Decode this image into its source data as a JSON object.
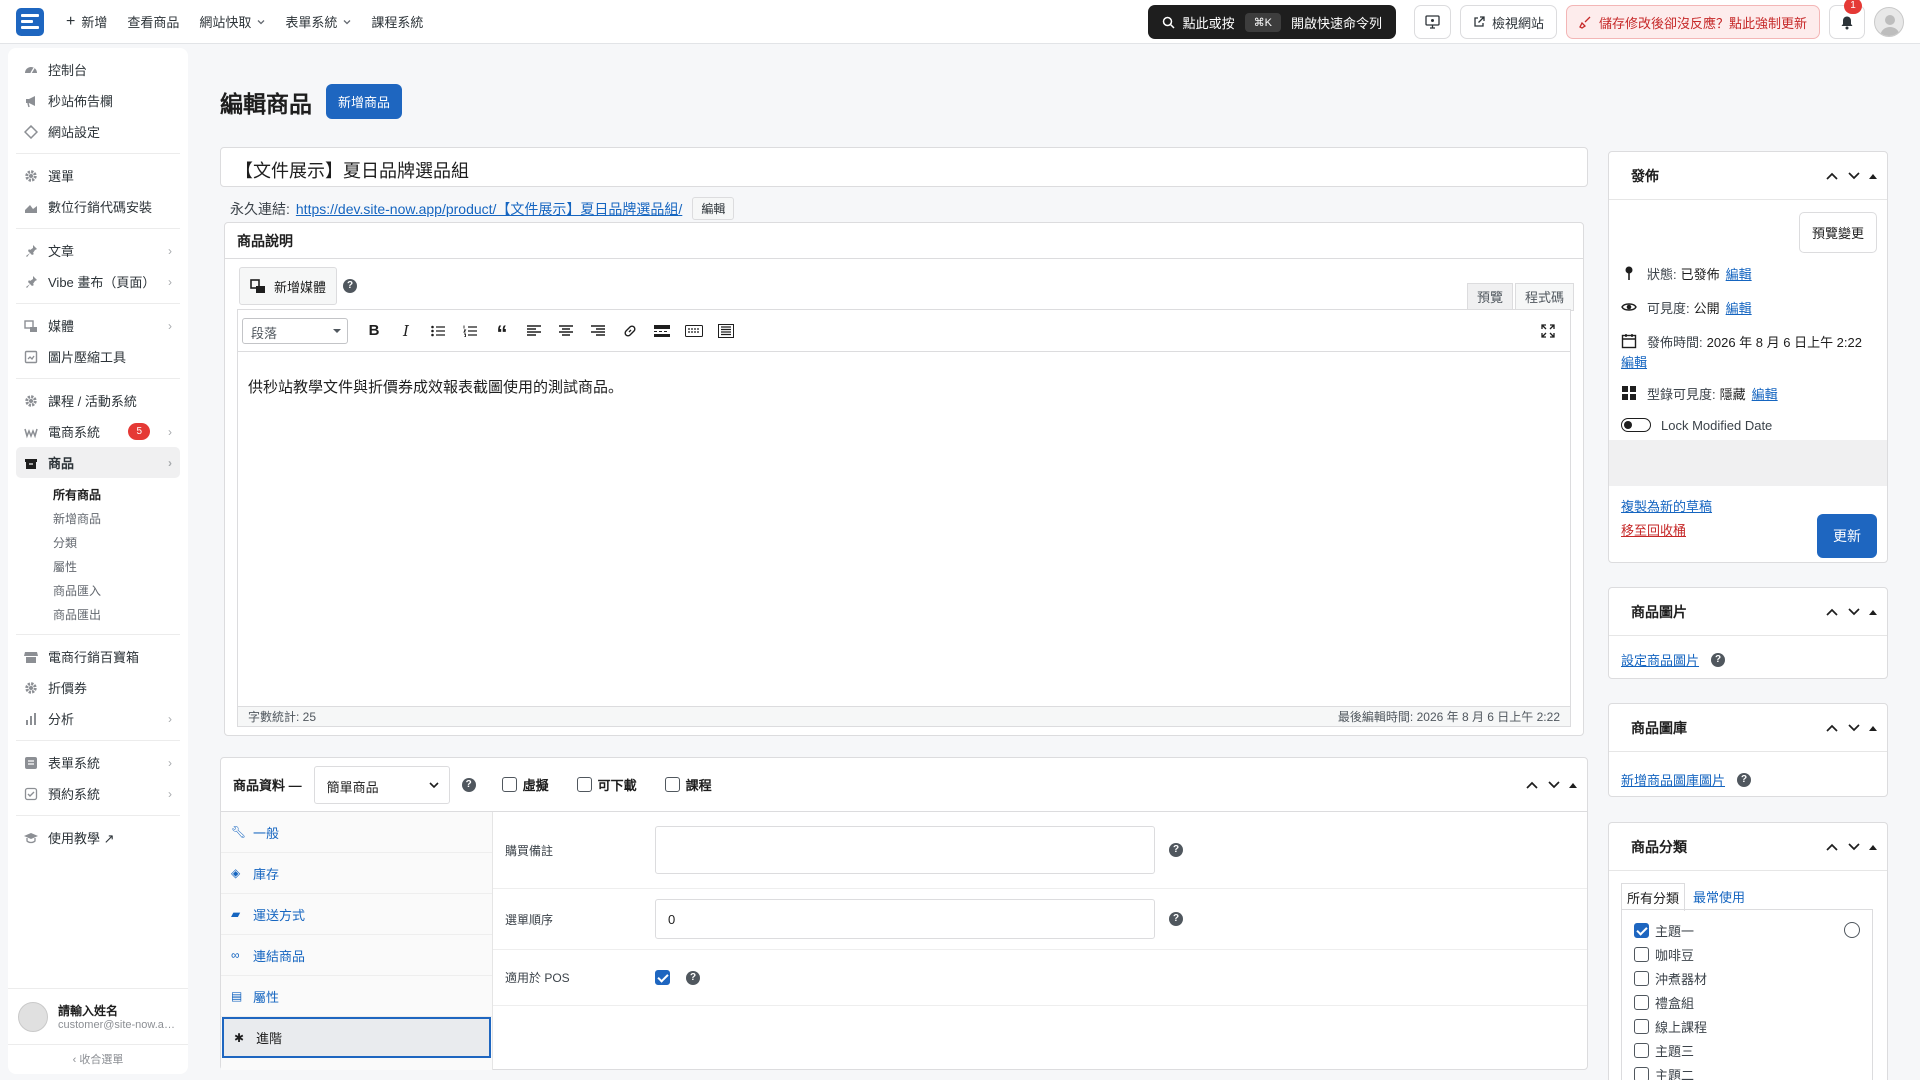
{
  "topbar": {
    "nav": [
      {
        "label": "新增",
        "icon": "plus-icon"
      },
      {
        "label": "查看商品"
      },
      {
        "label": "網站快取",
        "dropdown": true
      },
      {
        "label": "表單系統",
        "dropdown": true
      },
      {
        "label": "課程系統"
      }
    ],
    "command": {
      "prefix": "點此或按",
      "shortcut": "⌘K",
      "suffix": "開啟快速命令列"
    },
    "view_site": "檢視網站",
    "warning": "儲存修改後卻沒反應？點此強制更新",
    "notification_count": "1"
  },
  "sidebar": {
    "groups": [
      [
        {
          "label": "控制台",
          "icon": "dashboard-icon"
        },
        {
          "label": "秒站佈告欄",
          "icon": "megaphone-icon"
        },
        {
          "label": "網站設定",
          "icon": "diamond-icon"
        }
      ],
      [
        {
          "label": "選單",
          "icon": "gear-icon"
        },
        {
          "label": "數位行銷代碼安裝",
          "icon": "chart-icon"
        }
      ],
      [
        {
          "label": "文章",
          "icon": "pin-icon",
          "arrow": true
        },
        {
          "label": "Vibe 畫布（頁面）",
          "icon": "pin-icon",
          "arrow": true
        }
      ],
      [
        {
          "label": "媒體",
          "icon": "media-icon",
          "arrow": true
        },
        {
          "label": "圖片壓縮工具",
          "icon": "compress-icon"
        }
      ],
      [
        {
          "label": "課程 / 活動系統",
          "icon": "gear-icon"
        },
        {
          "label": "電商系統",
          "icon": "woo-icon",
          "badge": "5",
          "arrow": true
        },
        {
          "label": "商品",
          "icon": "box-icon",
          "arrow": true,
          "active": true
        }
      ]
    ],
    "sub_items": [
      "所有商品",
      "新增商品",
      "分類",
      "屬性",
      "商品匯入",
      "商品匯出"
    ],
    "groups2": [
      [
        {
          "label": "電商行銷百寶箱",
          "icon": "store-icon"
        },
        {
          "label": "折價券",
          "icon": "gear-icon"
        },
        {
          "label": "分析",
          "icon": "bars-icon",
          "arrow": true
        }
      ],
      [
        {
          "label": "表單系統",
          "icon": "form-icon",
          "arrow": true
        },
        {
          "label": "預約系統",
          "icon": "check-icon",
          "arrow": true
        }
      ],
      [
        {
          "label": "使用教學 ↗",
          "icon": "cap-icon"
        }
      ]
    ],
    "user": {
      "name": "請輸入姓名",
      "email": "customer@site-now.app"
    },
    "collapse": "收合選單"
  },
  "page": {
    "title": "編輯商品",
    "add_new": "新增商品",
    "product_title": "【文件展示】夏日品牌選品組",
    "permalink_label": "永久連結:",
    "permalink_url": "https://dev.site-now.app/product/【文件展示】夏日品牌選品組/",
    "permalink_edit": "編輯"
  },
  "description": {
    "heading": "商品說明",
    "add_media": "新增媒體",
    "tab_visual": "預覽",
    "tab_code": "程式碼",
    "format": "段落",
    "content": "供秒站教學文件與折價券成效報表截圖使用的測試商品。",
    "word_count": "字數統計: 25",
    "last_edited": "最後編輯時間: 2026 年 8 月 6 日上午 2:22"
  },
  "product_data": {
    "label": "商品資料 —",
    "type": "簡單商品",
    "options": [
      "虛擬",
      "可下載",
      "課程"
    ],
    "tabs": [
      {
        "label": "一般",
        "icon": "wrench-icon"
      },
      {
        "label": "庫存",
        "icon": "tag-icon"
      },
      {
        "label": "運送方式",
        "icon": "truck-icon"
      },
      {
        "label": "連結商品",
        "icon": "link-icon"
      },
      {
        "label": "屬性",
        "icon": "list-icon"
      },
      {
        "label": "進階",
        "icon": "gear-icon",
        "active": true
      }
    ],
    "fields": {
      "note_label": "購買備註",
      "note_value": "",
      "order_label": "選單順序",
      "order_value": "0",
      "pos_label": "適用於 POS"
    }
  },
  "publish": {
    "heading": "發佈",
    "preview": "預覽變更",
    "status_label": "狀態:",
    "status_value": "已發佈",
    "visibility_label": "可見度:",
    "visibility_value": "公開",
    "date_label": "發佈時間:",
    "date_value": "2026 年 8 月 6 日上午 2:22",
    "catalog_label": "型錄可見度:",
    "catalog_value": "隱藏",
    "edit": "編輯",
    "lock": "Lock Modified Date",
    "copy_draft": "複製為新的草稿",
    "trash": "移至回收桶",
    "update": "更新"
  },
  "product_image": {
    "heading": "商品圖片",
    "set_link": "設定商品圖片"
  },
  "gallery": {
    "heading": "商品圖庫",
    "add_link": "新增商品圖庫圖片"
  },
  "categories": {
    "heading": "商品分類",
    "tab_all": "所有分類",
    "tab_common": "最常使用",
    "items": [
      {
        "label": "主題一",
        "checked": true
      },
      {
        "label": "咖啡豆",
        "checked": false
      },
      {
        "label": "沖煮器材",
        "checked": false
      },
      {
        "label": "禮盒組",
        "checked": false
      },
      {
        "label": "線上課程",
        "checked": false
      },
      {
        "label": "主題三",
        "checked": false
      },
      {
        "label": "主題二",
        "checked": false
      }
    ]
  },
  "colors": {
    "accent": "#1e66c0",
    "danger": "#c62828",
    "badge": "#e53935"
  }
}
